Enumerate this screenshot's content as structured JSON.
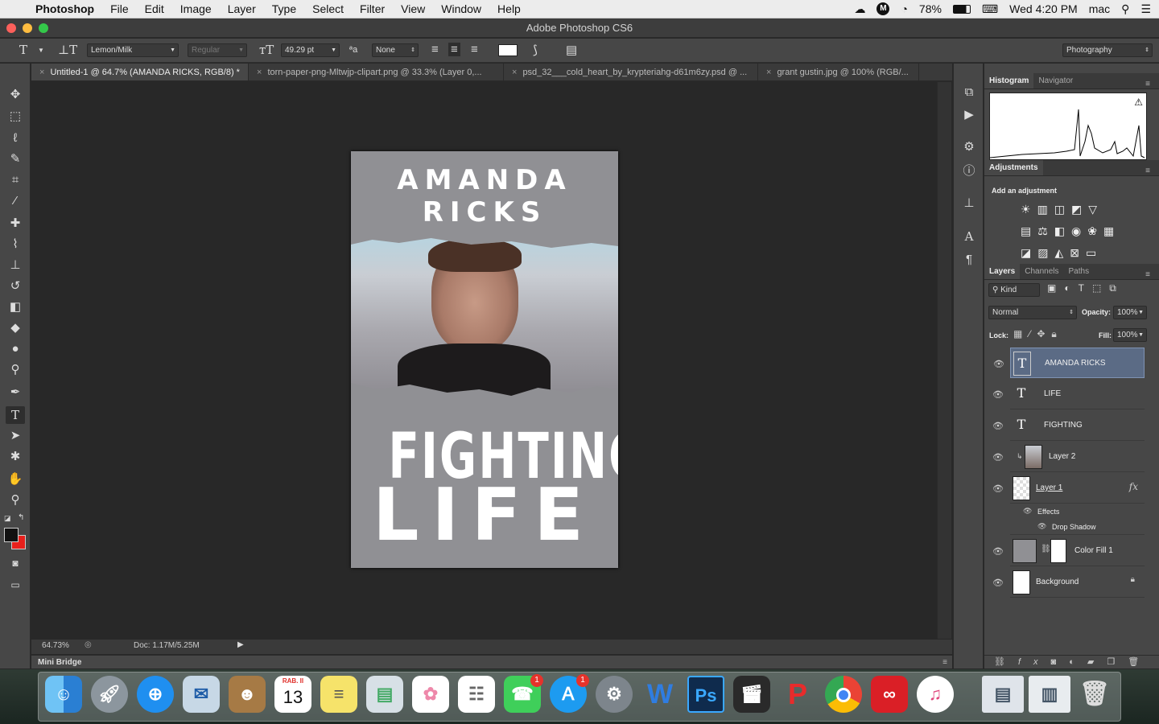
{
  "menubar": {
    "app": "Photoshop",
    "items": [
      "File",
      "Edit",
      "Image",
      "Layer",
      "Type",
      "Select",
      "Filter",
      "View",
      "Window",
      "Help"
    ],
    "battery": "78%",
    "datetime": "Wed 4:20 PM",
    "user": "mac"
  },
  "window": {
    "title": "Adobe Photoshop CS6"
  },
  "options": {
    "font_family": "Lemon/Milk",
    "font_style": "Regular",
    "font_size": "49.29 pt",
    "antialias": "None",
    "workspace": "Photography"
  },
  "tabs": [
    "Untitled-1 @ 64.7% (AMANDA RICKS, RGB/8) *",
    "torn-paper-png-Mltwjp-clipart.png @ 33.3% (Layer 0,...",
    "psd_32___cold_heart_by_krypteriahg-d61m6zy.psd @ ...",
    "grant gustin.jpg @ 100% (RGB/..."
  ],
  "canvas": {
    "title": "AMANDA RICKS",
    "big1": "FIGHTING",
    "big2": "LIFE"
  },
  "status": {
    "zoom": "64.73%",
    "doc": "Doc: 1.17M/5.25M"
  },
  "minibridge": "Mini Bridge",
  "panels": {
    "histogram_tab": "Histogram",
    "navigator_tab": "Navigator",
    "adjustments_tab": "Adjustments",
    "add_adjustment": "Add an adjustment",
    "layers_tab": "Layers",
    "channels_tab": "Channels",
    "paths_tab": "Paths",
    "kind": "Kind",
    "blend": "Normal",
    "opacity_label": "Opacity:",
    "opacity": "100%",
    "lock_label": "Lock:",
    "fill_label": "Fill:",
    "fill": "100%",
    "layers": [
      "AMANDA RICKS",
      "LIFE",
      "FIGHTING",
      "Layer 2",
      "Layer 1",
      "Color Fill 1",
      "Background"
    ],
    "effects": "Effects",
    "drop_shadow": "Drop Shadow"
  },
  "dock": {
    "calendar_month": "RAB. II",
    "calendar_day": "13",
    "facetime_badge": "1",
    "appstore_badge": "1",
    "ps_label": "Ps",
    "word_label": "W"
  }
}
